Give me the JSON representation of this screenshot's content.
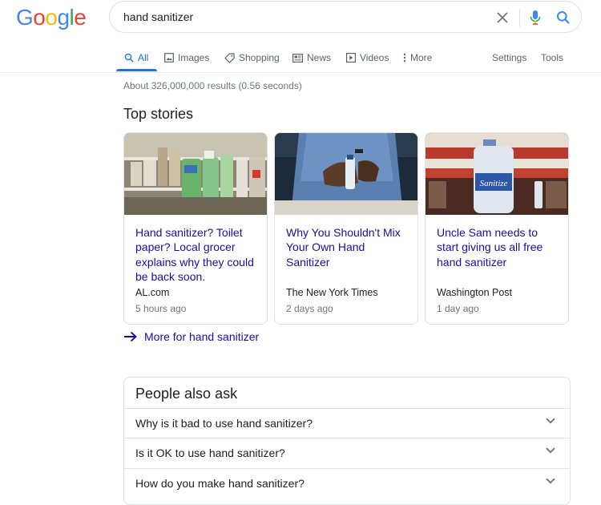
{
  "logo": {
    "letters": [
      "G",
      "o",
      "o",
      "g",
      "l",
      "e"
    ],
    "colors": [
      "#4285f4",
      "#ea4335",
      "#fbbc05",
      "#4285f4",
      "#34a853",
      "#ea4335"
    ]
  },
  "search": {
    "query": "hand sanitizer",
    "clear_icon": "close-icon",
    "voice_icon": "mic-icon",
    "search_icon": "search-icon"
  },
  "tabs": [
    {
      "label": "All",
      "icon": "search-icon",
      "active": true
    },
    {
      "label": "Images",
      "icon": "image-icon"
    },
    {
      "label": "Shopping",
      "icon": "tag-icon"
    },
    {
      "label": "News",
      "icon": "newspaper-icon"
    },
    {
      "label": "Videos",
      "icon": "play-icon"
    },
    {
      "label": "More",
      "icon": "more-vert-icon"
    }
  ],
  "tools": {
    "settings": "Settings",
    "tools": "Tools"
  },
  "results_stats": "About 326,000,000 results (0.56 seconds)",
  "top_stories": {
    "title": "Top stories",
    "cards": [
      {
        "headline": "Hand sanitizer? Toilet paper? Local grocer explains why they could be back soon.",
        "source": "AL.com",
        "time": "5 hours ago"
      },
      {
        "headline": "Why You Shouldn't Mix Your Own Hand Sanitizer",
        "source": "The New York Times",
        "time": "2 days ago"
      },
      {
        "headline": "Uncle Sam needs to start giving us all free hand sanitizer",
        "source": "Washington Post",
        "time": "1 day ago"
      }
    ],
    "more_label": "More for hand sanitizer"
  },
  "people_also_ask": {
    "title": "People also ask",
    "questions": [
      "Why is it bad to use hand sanitizer?",
      "Is it OK to use hand sanitizer?",
      "How do you make hand sanitizer?"
    ]
  },
  "colors": {
    "link": "#1a0dab",
    "accent": "#1a73e8",
    "muted": "#70757a"
  }
}
